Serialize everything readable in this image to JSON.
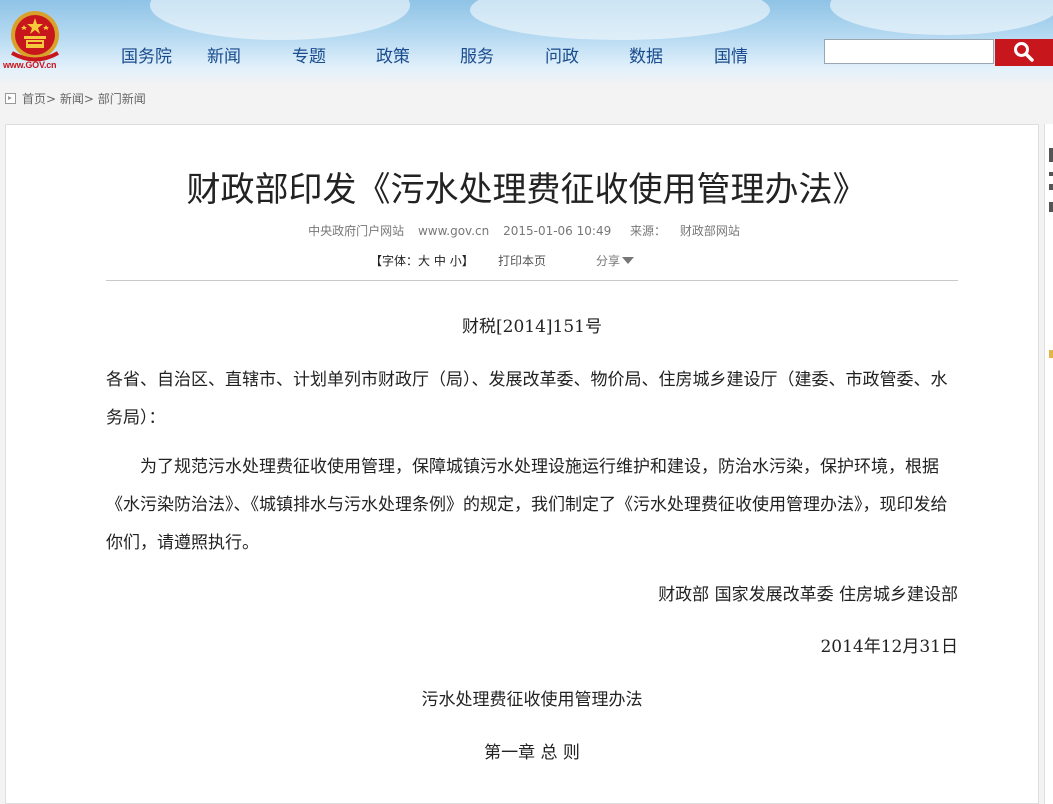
{
  "header": {
    "logo_text": "www.GOV.cn",
    "nav": [
      "国务院",
      "新闻",
      "专题",
      "政策",
      "服务",
      "问政",
      "数据",
      "国情"
    ],
    "search": {
      "placeholder": ""
    }
  },
  "breadcrumb": [
    "首页",
    "新闻",
    "部门新闻"
  ],
  "article": {
    "title": "财政部印发《污水处理费征收使用管理办法》",
    "meta": {
      "source_site": "中央政府门户网站",
      "url": "www.gov.cn",
      "datetime": "2015-01-06 10:49",
      "source_label": "来源：",
      "source": "财政部网站"
    },
    "tools": {
      "font_label_prefix": "【字体：",
      "font_large": "大",
      "font_medium": "中",
      "font_small": "小",
      "font_label_suffix": "】",
      "print": "打印本页",
      "share": "分享"
    },
    "doc_number": "财税[2014]151号",
    "addressees": "各省、自治区、直辖市、计划单列市财政厅（局）、发展改革委、物价局、住房城乡建设厅（建委、市政管委、水务局）：",
    "paragraph": "为了规范污水处理费征收使用管理，保障城镇污水处理设施运行维护和建设，防治水污染，保护环境，根据《水污染防治法》、《城镇排水与污水处理条例》的规定，我们制定了《污水处理费征收使用管理办法》，现印发给你们，请遵照执行。",
    "signatories": "财政部 国家发展改革委 住房城乡建设部",
    "date": "2014年12月31日",
    "doc_title": "污水处理费征收使用管理办法",
    "chapter": "第一章 总 则"
  }
}
